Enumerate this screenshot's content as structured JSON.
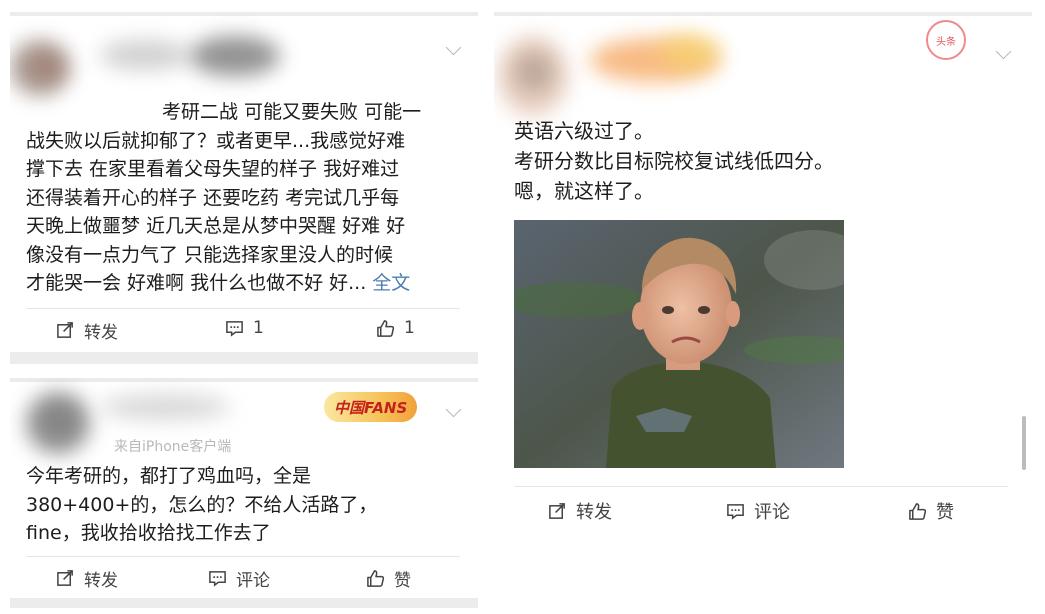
{
  "post1": {
    "lines": [
      "考研二战 可能又要失败 可能一",
      "战失败以后就抑郁了？或者更早...我感觉好难",
      "撑下去 在家里看着父母失望的样子 我好难过",
      "还得装着开心的样子 还要吃药 考完试几乎每",
      "天晚上做噩梦 近几天总是从梦中哭醒 好难 好",
      "像没有一点力气了 只能选择家里没人的时候",
      "才能哭一会 好难啊 我什么也做不好 好..."
    ],
    "more_label": "全文",
    "repost_label": "转发",
    "comment_count": "1",
    "like_count": "1"
  },
  "post2": {
    "source": "来自iPhone客户端",
    "badge": "中国FANS",
    "lines": [
      "今年考研的，都打了鸡血吗，全是",
      "380+400+的，怎么的？不给人活路了，",
      "fine，我收拾收拾找工作去了"
    ],
    "repost_label": "转发",
    "comment_label": "评论",
    "like_label": "赞"
  },
  "post3": {
    "stamp": "头条",
    "lines": [
      "英语六级过了。",
      "考研分数比目标院校复试线低四分。",
      "嗯，就这样了。"
    ],
    "repost_label": "转发",
    "comment_label": "评论",
    "like_label": "赞"
  },
  "colors": {
    "link": "#507daf",
    "text": "#1d1d1d",
    "action_text": "#444444",
    "separator": "#ececec"
  }
}
